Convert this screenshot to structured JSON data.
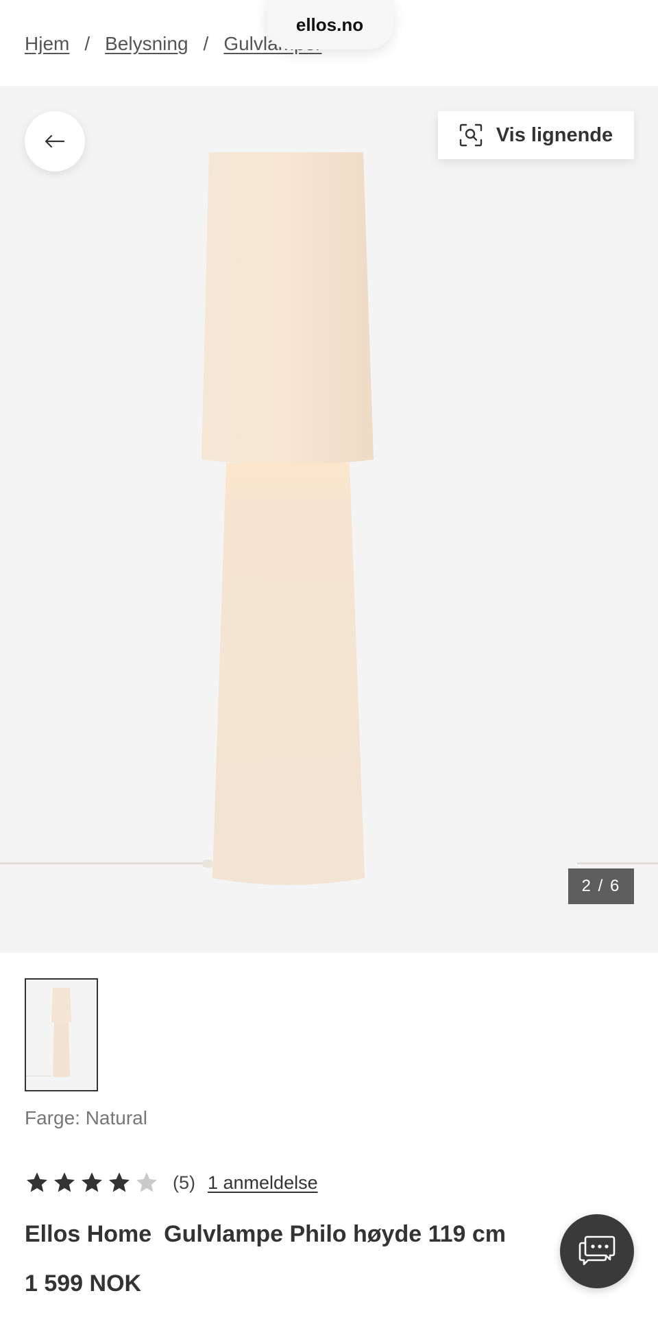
{
  "browser": {
    "url": "ellos.no"
  },
  "breadcrumb": {
    "items": [
      "Hjem",
      "Belysning",
      "Gulvlamper"
    ],
    "separator": "/"
  },
  "gallery": {
    "back_icon": "arrow-left-icon",
    "similar_button": {
      "label": "Vis lignende",
      "icon": "visual-search-icon"
    },
    "counter": "2 / 6",
    "image_index": 2,
    "image_total": 6
  },
  "product": {
    "color_label": "Farge: Natural",
    "rating": {
      "value": 4,
      "max": 5,
      "count_text": "(5)",
      "reviews_link": "1 anmeldelse"
    },
    "brand": "Ellos Home",
    "name": "Gulvlampe Philo høyde 119 cm",
    "price": "1 599 NOK"
  },
  "chat": {
    "icon": "chat-bubbles-icon"
  },
  "colors": {
    "lamp": "#f3e4d3",
    "background": "#f4f4f4",
    "counter_bg": "#5e5e5e",
    "chat_bg": "#3a3a3a"
  }
}
